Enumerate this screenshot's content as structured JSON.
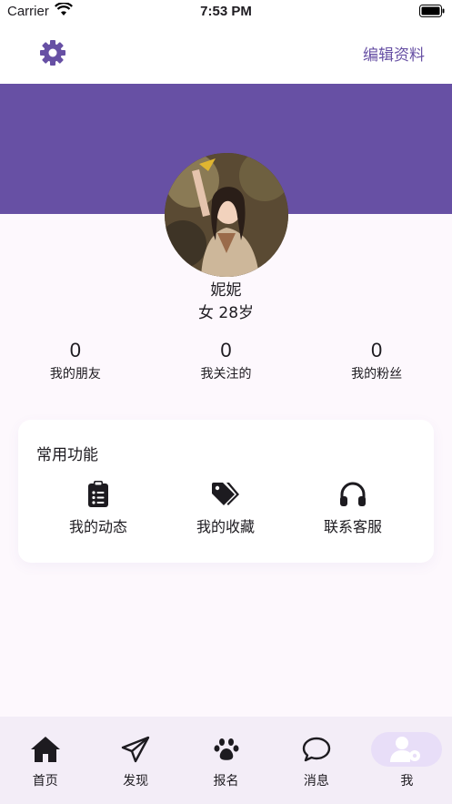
{
  "status": {
    "carrier": "Carrier",
    "time": "7:53 PM"
  },
  "header": {
    "edit_label": "编辑资料"
  },
  "profile": {
    "name": "妮妮",
    "meta": "女 28岁"
  },
  "stats": [
    {
      "value": "0",
      "label": "我的朋友"
    },
    {
      "value": "0",
      "label": "我关注的"
    },
    {
      "value": "0",
      "label": "我的粉丝"
    }
  ],
  "functions": {
    "title": "常用功能",
    "items": [
      {
        "label": "我的动态",
        "icon": "clipboard-list-icon"
      },
      {
        "label": "我的收藏",
        "icon": "tags-icon"
      },
      {
        "label": "联系客服",
        "icon": "headphones-icon"
      }
    ]
  },
  "tabs": [
    {
      "label": "首页",
      "icon": "home-icon"
    },
    {
      "label": "发现",
      "icon": "paper-plane-icon"
    },
    {
      "label": "报名",
      "icon": "paw-icon"
    },
    {
      "label": "消息",
      "icon": "chat-bubble-icon"
    },
    {
      "label": "我",
      "icon": "user-gear-icon",
      "active": true
    }
  ],
  "colors": {
    "accent": "#6750a4",
    "tab_bg": "#f3edf7",
    "active_pill": "#e8def8"
  }
}
